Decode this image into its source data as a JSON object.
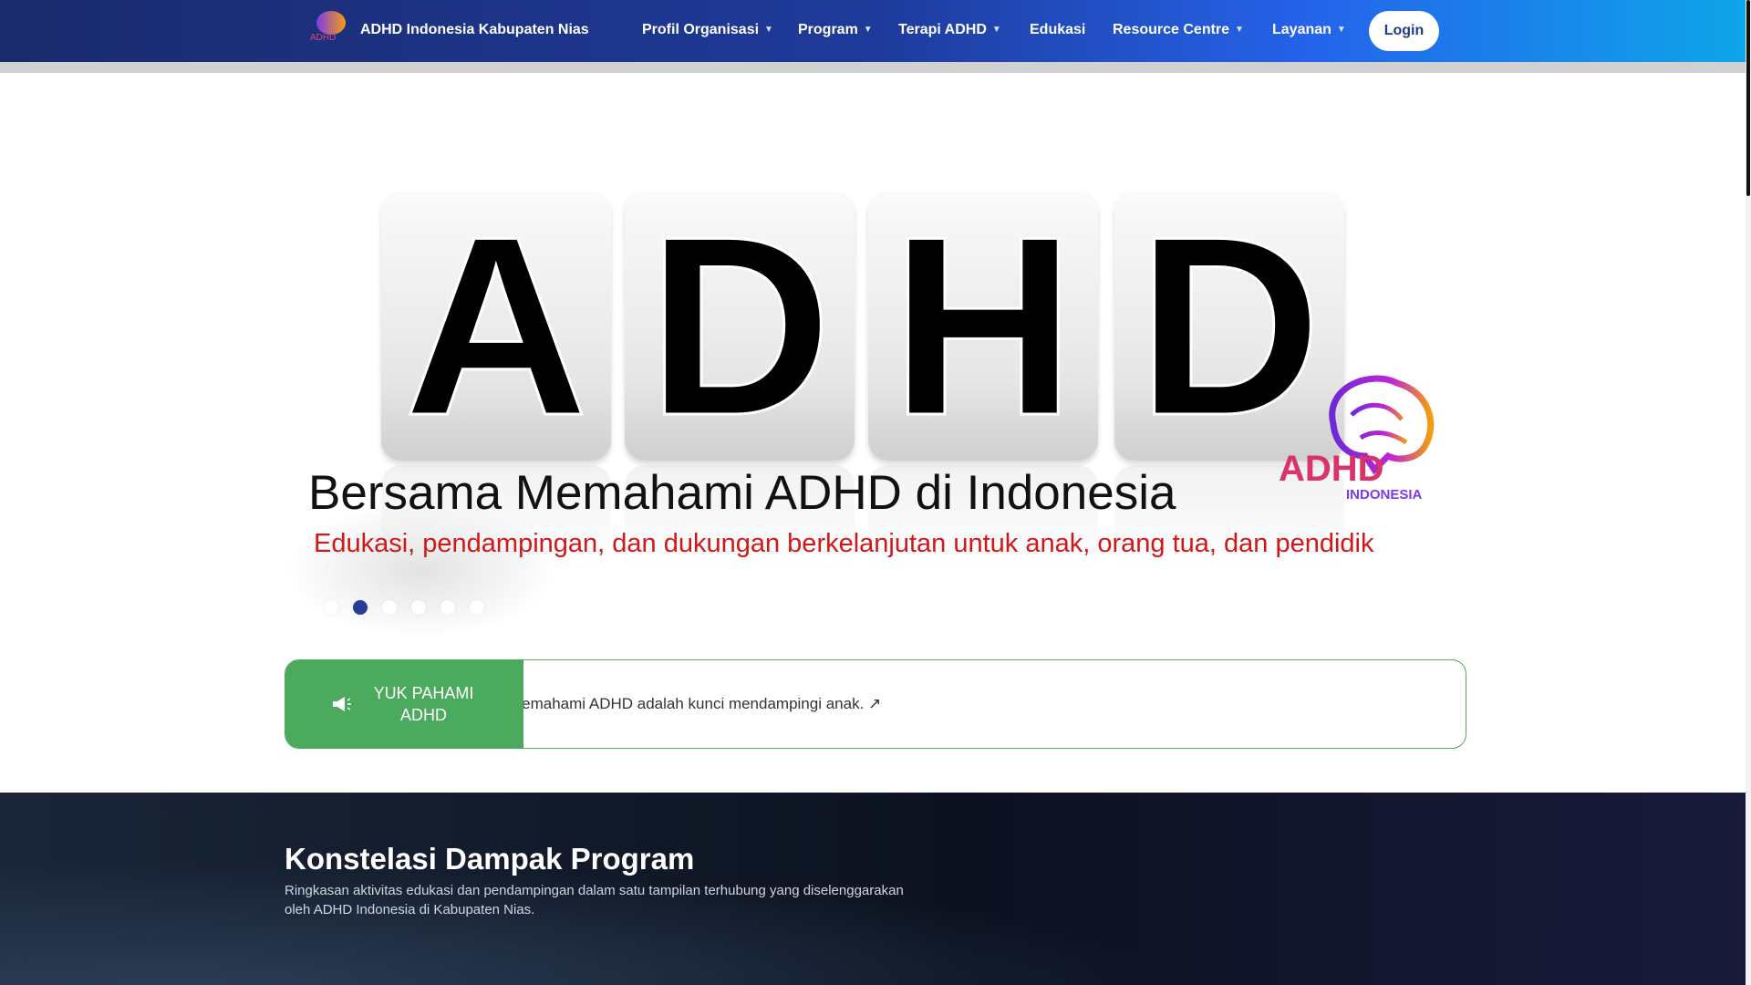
{
  "header": {
    "title": "ADHD Indonesia Kabupaten Nias",
    "nav": [
      {
        "label": "Profil Organisasi",
        "dropdown": true
      },
      {
        "label": "Program",
        "dropdown": true
      },
      {
        "label": "Terapi ADHD",
        "dropdown": true
      },
      {
        "label": "Edukasi",
        "dropdown": false
      },
      {
        "label": "Resource Centre",
        "dropdown": true
      },
      {
        "label": "Layanan",
        "dropdown": true
      }
    ],
    "caret": "▼",
    "login_label": "Login"
  },
  "hero": {
    "letters": [
      "A",
      "D",
      "H",
      "D"
    ],
    "title": "Bersama Memahami ADHD di Indonesia",
    "subtitle": "Edukasi, pendampingan, dan dukungan berkelanjutan untuk anak, orang tua, dan pendidik",
    "brand_logo_text": "ADHD INDONESIA",
    "slide_count": 6,
    "active_slide": 2
  },
  "ticker": {
    "label": "YUK PAHAMI ADHD",
    "text": "Memahami ADHD adalah kunci mendampingi anak.",
    "link_icon": "↗"
  },
  "section": {
    "title": "Konstelasi Dampak Program",
    "description": "Ringkasan aktivitas edukasi dan pendampingan dalam satu tampilan terhubung yang diselenggarakan oleh ADHD Indonesia di Kabupaten Nias."
  }
}
